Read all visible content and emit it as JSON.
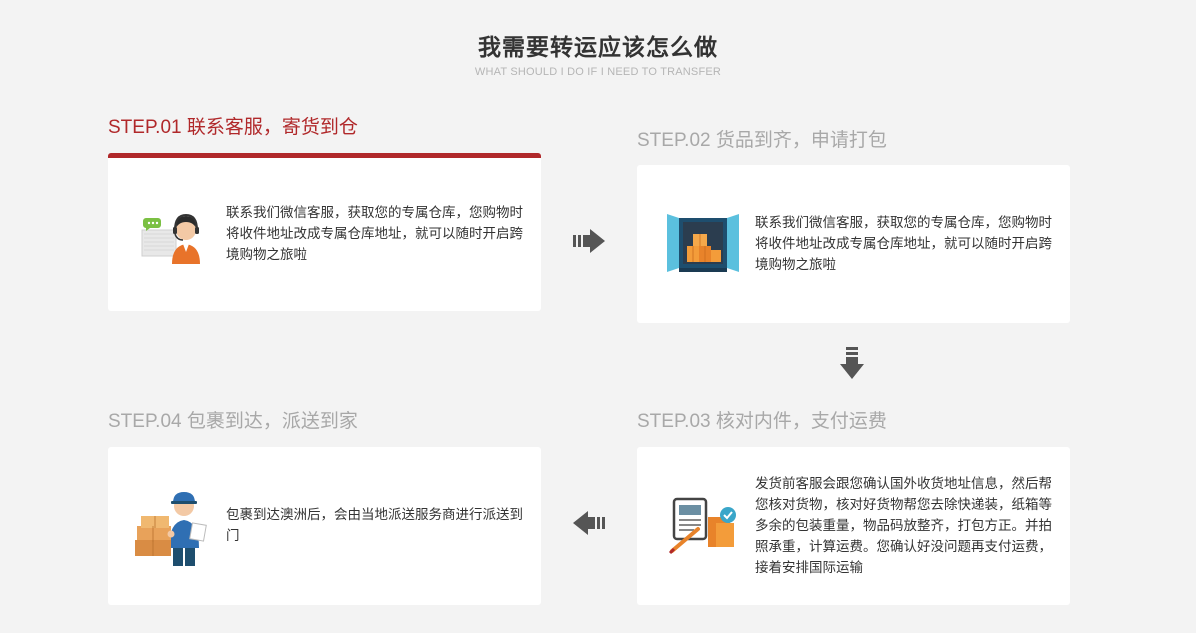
{
  "header": {
    "title": "我需要转运应该怎么做",
    "subtitle": "WHAT SHOULD I DO IF I NEED TO TRANSFER"
  },
  "steps": [
    {
      "label": "STEP.01 联系客服，寄货到仓",
      "description": "联系我们微信客服，获取您的专属仓库，您购物时将收件地址改成专属仓库地址，就可以随时开启跨境购物之旅啦",
      "icon": "customer-service-icon",
      "active": true
    },
    {
      "label": "STEP.02 货品到齐，申请打包",
      "description": "联系我们微信客服，获取您的专属仓库，您购物时将收件地址改成专属仓库地址，就可以随时开启跨境购物之旅啦",
      "icon": "warehouse-boxes-icon",
      "active": false
    },
    {
      "label": "STEP.03 核对内件，支付运费",
      "description": "发货前客服会跟您确认国外收货地址信息，然后帮您核对货物，核对好货物帮您去除快递装，纸箱等多余的包装重量，物品码放整齐，打包方正。并拍照承重，计算运费。您确认好没问题再支付运费，接着安排国际运输",
      "icon": "checklist-package-icon",
      "active": false
    },
    {
      "label": "STEP.04 包裹到达，派送到家",
      "description": "包裹到达澳洲后，会由当地派送服务商进行派送到门",
      "icon": "delivery-person-icon",
      "active": false
    }
  ],
  "colors": {
    "accent": "#b0282a",
    "inactive_heading": "#a8a8a8",
    "background": "#f3f3f3",
    "arrow": "#555555"
  },
  "arrows": [
    "arrow-right-icon",
    "arrow-down-icon",
    "arrow-left-icon"
  ]
}
